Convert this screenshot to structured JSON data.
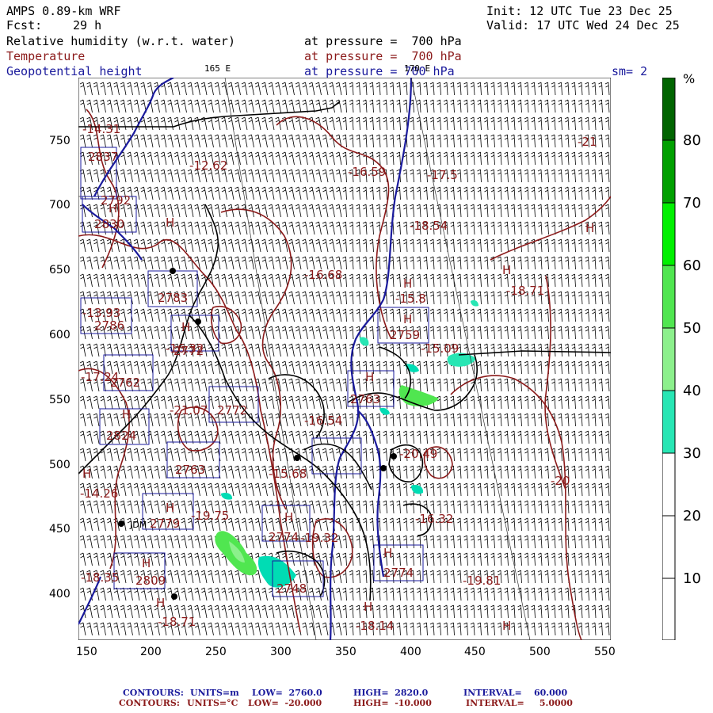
{
  "header": {
    "model": "AMPS 0.89-km WRF",
    "init": "Init: 12 UTC Tue 23 Dec 25",
    "fcst_label": "Fcst:",
    "fcst_value": "29 h",
    "valid": "Valid: 17 UTC Wed 24 Dec 25",
    "var1": "Relative humidity (w.r.t. water)",
    "var1_level": "at pressure =  700 hPa",
    "var2": "Temperature",
    "var2_level": "at pressure =  700 hPa",
    "var3": "Geopotential height",
    "var3_level": "at pressure = 700 hPa",
    "lon_marker": "165 E",
    "lon_marker2": "170 E",
    "sm": "sm= 2"
  },
  "colors": {
    "rh_fill": "#00dcb4",
    "rh_30": "#28e6b4",
    "rh_40": "#8cf08c",
    "rh_50": "#50e650",
    "rh_60": "#00f000",
    "rh_70": "#00a000",
    "rh_80": "#006400",
    "temp": "#8b1a1a",
    "height": "#1a1a9c",
    "coast": "#000000"
  },
  "axes": {
    "x_ticks": [
      "150",
      "200",
      "250",
      "300",
      "350",
      "400",
      "450",
      "500",
      "550"
    ],
    "y_ticks": [
      "750",
      "700",
      "650",
      "600",
      "550",
      "500",
      "450",
      "400"
    ]
  },
  "colorbar": {
    "unit": "%",
    "labels": [
      "80",
      "70",
      "60",
      "50",
      "40",
      "30",
      "20",
      "10"
    ]
  },
  "map_labels": {
    "temps": [
      "-12.62",
      "-16.59",
      "-17.5",
      "-18.54",
      "-16.68",
      "-15.8",
      "-18.71",
      "-15.09",
      "-16.32",
      "-21.07",
      "-16.54",
      "-20.49",
      "-15.68",
      "-14.26",
      "-19.75",
      "-16.32",
      "-19.81",
      "-18.71",
      "-18.14",
      "-20",
      "-21",
      "-17.24",
      "-13.93",
      "-18.35",
      "-14.31",
      "-19.32"
    ],
    "heights": [
      "2837",
      "2830",
      "2783",
      "2786",
      "2759",
      "2762",
      "2772",
      "2763",
      "2763",
      "2779",
      "2809",
      "2748",
      "2774",
      "2774",
      "2824",
      "2792",
      "2772"
    ],
    "highs": [
      "H",
      "H",
      "H",
      "H",
      "H",
      "H",
      "H",
      "H",
      "H",
      "H",
      "H",
      "H",
      "H",
      "H",
      "H",
      "H",
      "H"
    ],
    "stations": [
      "JDM"
    ]
  },
  "footer": {
    "line1": {
      "label": "CONTOURS:",
      "units": "UNITS=m",
      "low": "LOW=  2760.0",
      "high": "HIGH=  2820.0",
      "interval": "INTERVAL=    60.000"
    },
    "line2": {
      "label": "CONTOURS:",
      "units": "UNITS=°C",
      "low": "LOW=  -20.000",
      "high": "HIGH=  -10.000",
      "interval": "INTERVAL=     5.0000"
    }
  }
}
